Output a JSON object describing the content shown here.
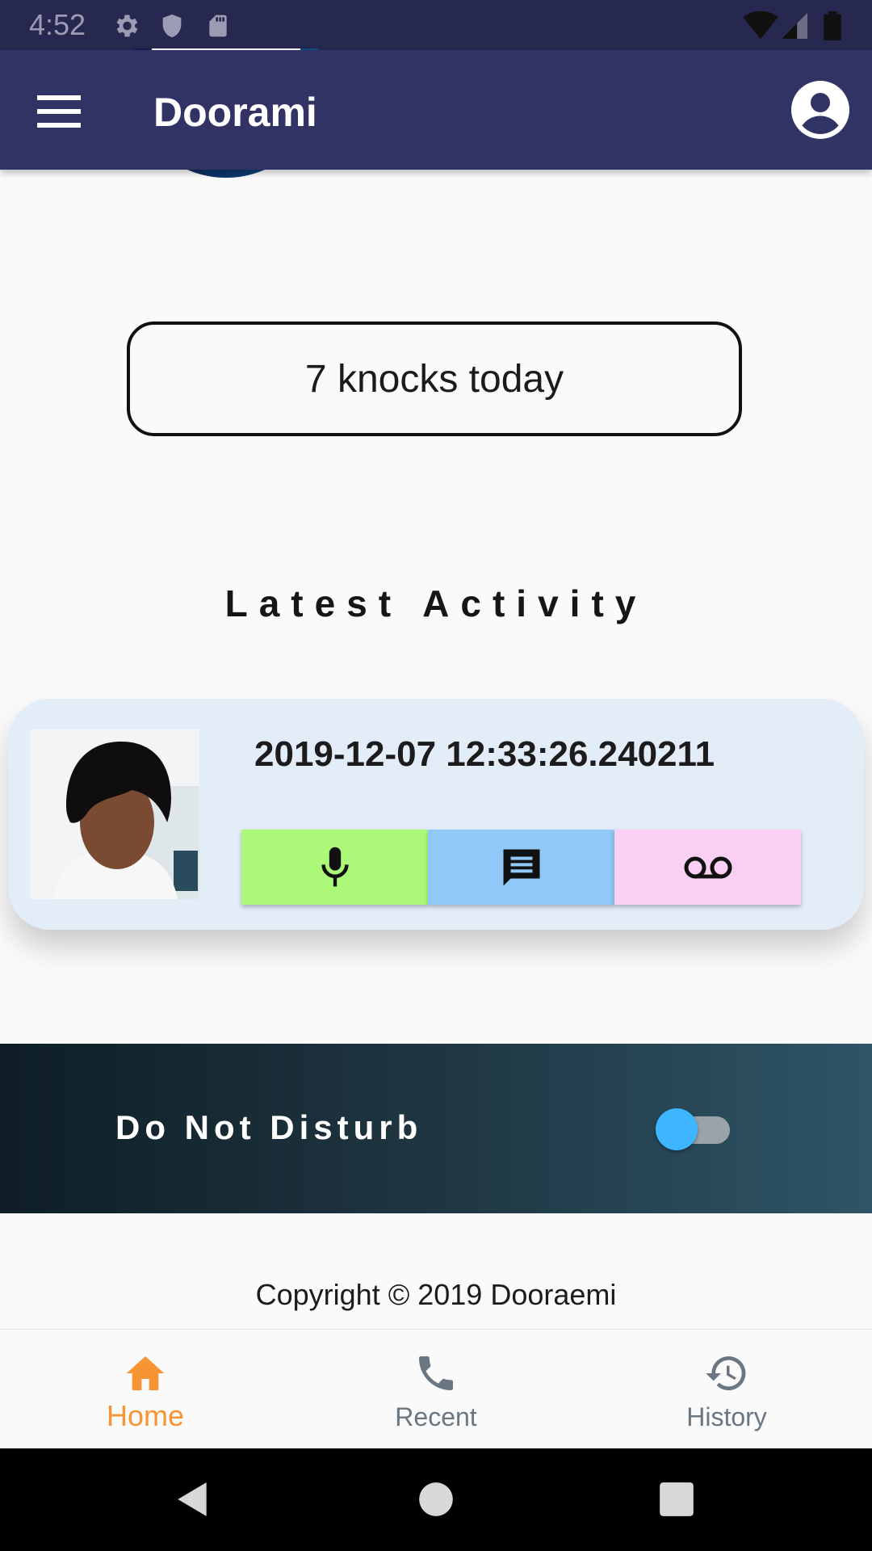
{
  "status_bar": {
    "time": "4:52",
    "icons": [
      "settings-icon",
      "shield-icon",
      "sd-card-icon",
      "wifi-icon",
      "signal-icon",
      "battery-icon"
    ]
  },
  "app_bar": {
    "title": "Doorami",
    "icons": [
      "menu-icon",
      "account-circle-icon"
    ]
  },
  "knocks": {
    "text": "7 knocks today"
  },
  "latest_activity": {
    "heading": "Latest Activity",
    "timestamp": "2019-12-07 12:33:26.240211",
    "actions": [
      {
        "name": "mic",
        "icon": "mic-icon",
        "color": "#acf97a"
      },
      {
        "name": "message",
        "icon": "message-icon",
        "color": "#90c8f7"
      },
      {
        "name": "voicemail",
        "icon": "voicemail-icon",
        "color": "#f9d0f3"
      }
    ]
  },
  "do_not_disturb": {
    "label": "Do Not Disturb",
    "enabled": false,
    "thumb_color": "#3eb6ff"
  },
  "footer": {
    "copyright": "Copyright © 2019 Dooraemi"
  },
  "bottom_nav": {
    "items": [
      {
        "label": "Home",
        "icon": "home-icon",
        "active": true
      },
      {
        "label": "Recent",
        "icon": "phone-icon",
        "active": false
      },
      {
        "label": "History",
        "icon": "history-icon",
        "active": false
      }
    ],
    "active_color": "#f79433",
    "inactive_color": "#6b7683"
  },
  "colors": {
    "app_bar": "#323365",
    "status_bar": "#27284f",
    "card_background": "#e3edf8"
  }
}
